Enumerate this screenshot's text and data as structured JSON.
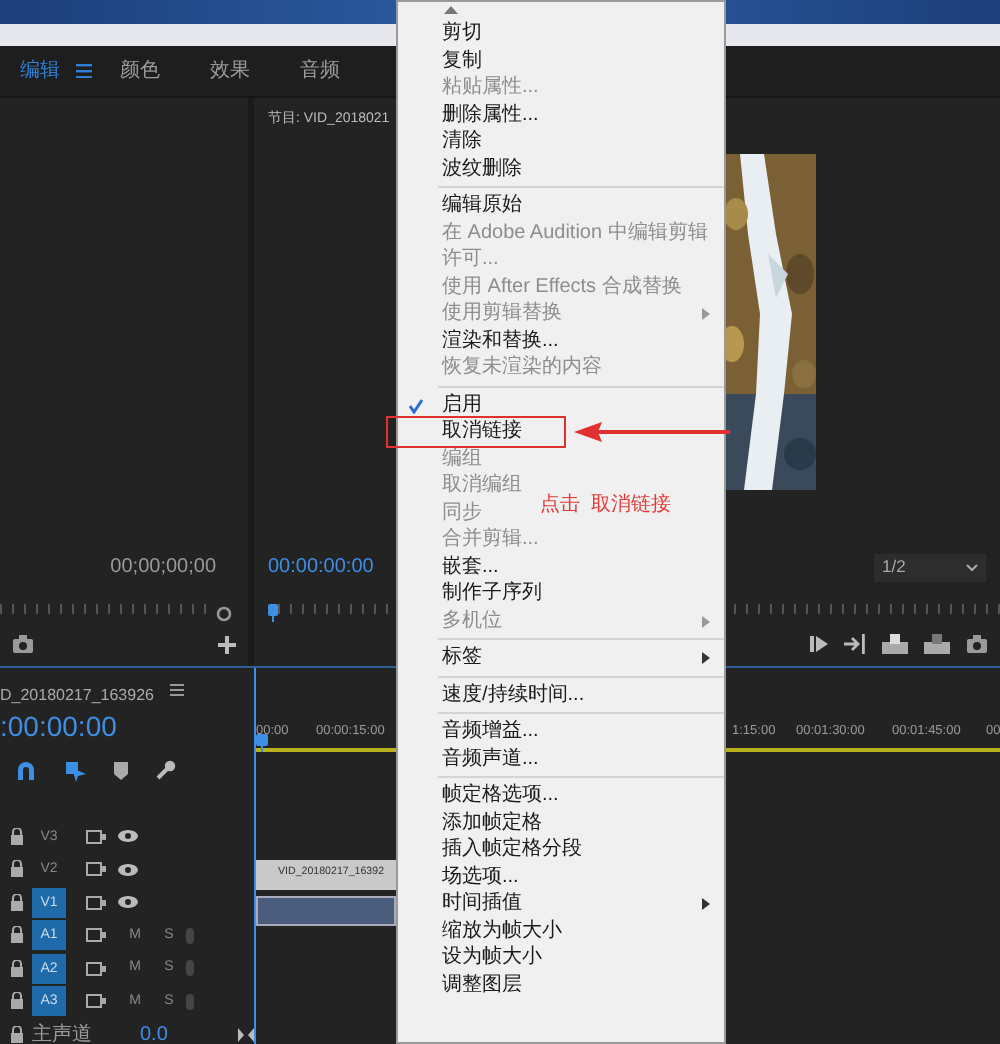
{
  "workspace_tabs": [
    {
      "label": "编辑",
      "selected": true
    },
    {
      "label": "颜色",
      "selected": false
    },
    {
      "label": "效果",
      "selected": false
    },
    {
      "label": "音频",
      "selected": false
    }
  ],
  "source_monitor": {
    "timecode": "00;00;00;00"
  },
  "program_monitor": {
    "title": "节目: VID_2018021",
    "timecode": "00:00:00:00",
    "zoom": "1/2"
  },
  "timeline": {
    "title": "D_20180217_163926",
    "timecode": ":00:00:00",
    "ruler_labels": [
      "00:00",
      "00:00:15:00",
      "1:15:00",
      "00:01:30:00",
      "00:01:45:00",
      "00"
    ],
    "tracks": [
      {
        "label": "V3",
        "kind": "video",
        "targeted": false
      },
      {
        "label": "V2",
        "kind": "video",
        "targeted": false
      },
      {
        "label": "V1",
        "kind": "video",
        "targeted": true
      },
      {
        "label": "A1",
        "kind": "audio",
        "targeted": true,
        "mute": "M",
        "solo": "S"
      },
      {
        "label": "A2",
        "kind": "audio",
        "targeted": true,
        "mute": "M",
        "solo": "S"
      },
      {
        "label": "A3",
        "kind": "audio",
        "targeted": true,
        "mute": "M",
        "solo": "S"
      }
    ],
    "master": {
      "label": "主声道",
      "value": "0.0"
    },
    "video_clip": {
      "label": "VID_20180217_16392"
    }
  },
  "context_menu": {
    "items": [
      {
        "kind": "item",
        "label": "剪切",
        "disabled": false,
        "checked": false,
        "submenu": false,
        "marked": false
      },
      {
        "kind": "item",
        "label": "复制",
        "disabled": false,
        "checked": false,
        "submenu": false,
        "marked": false
      },
      {
        "kind": "item",
        "label": "粘贴属性...",
        "disabled": true,
        "checked": false,
        "submenu": false,
        "marked": false
      },
      {
        "kind": "item",
        "label": "删除属性...",
        "disabled": false,
        "checked": false,
        "submenu": false,
        "marked": false
      },
      {
        "kind": "item",
        "label": "清除",
        "disabled": false,
        "checked": false,
        "submenu": false,
        "marked": false
      },
      {
        "kind": "item",
        "label": "波纹删除",
        "disabled": false,
        "checked": false,
        "submenu": false,
        "marked": false
      },
      {
        "kind": "separator"
      },
      {
        "kind": "item",
        "label": "编辑原始",
        "disabled": false,
        "checked": false,
        "submenu": false,
        "marked": false
      },
      {
        "kind": "item",
        "label": "在 Adobe Audition 中编辑剪辑",
        "disabled": true,
        "checked": false,
        "submenu": false,
        "marked": false
      },
      {
        "kind": "item",
        "label": "许可...",
        "disabled": true,
        "checked": false,
        "submenu": false,
        "marked": false
      },
      {
        "kind": "item",
        "label": "使用 After Effects 合成替换",
        "disabled": true,
        "checked": false,
        "submenu": false,
        "marked": false
      },
      {
        "kind": "item",
        "label": "使用剪辑替换",
        "disabled": true,
        "checked": false,
        "submenu": true,
        "marked": false
      },
      {
        "kind": "item",
        "label": "渲染和替换...",
        "disabled": false,
        "checked": false,
        "submenu": false,
        "marked": false
      },
      {
        "kind": "item",
        "label": "恢复未渲染的内容",
        "disabled": true,
        "checked": false,
        "submenu": false,
        "marked": false
      },
      {
        "kind": "separator"
      },
      {
        "kind": "item",
        "label": "启用",
        "disabled": false,
        "checked": true,
        "submenu": false,
        "marked": false
      },
      {
        "kind": "item",
        "label": "取消链接",
        "disabled": false,
        "checked": false,
        "submenu": false,
        "marked": true
      },
      {
        "kind": "item",
        "label": "编组",
        "disabled": true,
        "checked": false,
        "submenu": false,
        "marked": false
      },
      {
        "kind": "item",
        "label": "取消编组",
        "disabled": true,
        "checked": false,
        "submenu": false,
        "marked": false
      },
      {
        "kind": "item",
        "label": "同步",
        "disabled": true,
        "checked": false,
        "submenu": false,
        "marked": false
      },
      {
        "kind": "item",
        "label": "合并剪辑...",
        "disabled": true,
        "checked": false,
        "submenu": false,
        "marked": false
      },
      {
        "kind": "item",
        "label": "嵌套...",
        "disabled": false,
        "checked": false,
        "submenu": false,
        "marked": false
      },
      {
        "kind": "item",
        "label": "制作子序列",
        "disabled": false,
        "checked": false,
        "submenu": false,
        "marked": false
      },
      {
        "kind": "item",
        "label": "多机位",
        "disabled": true,
        "checked": false,
        "submenu": true,
        "marked": false
      },
      {
        "kind": "separator"
      },
      {
        "kind": "item",
        "label": "标签",
        "disabled": false,
        "checked": false,
        "submenu": true,
        "marked": false
      },
      {
        "kind": "separator"
      },
      {
        "kind": "item",
        "label": "速度/持续时间...",
        "disabled": false,
        "checked": false,
        "submenu": false,
        "marked": false
      },
      {
        "kind": "separator"
      },
      {
        "kind": "item",
        "label": "音频增益...",
        "disabled": false,
        "checked": false,
        "submenu": false,
        "marked": false
      },
      {
        "kind": "item",
        "label": "音频声道...",
        "disabled": false,
        "checked": false,
        "submenu": false,
        "marked": false
      },
      {
        "kind": "separator"
      },
      {
        "kind": "item",
        "label": "帧定格选项...",
        "disabled": false,
        "checked": false,
        "submenu": false,
        "marked": false
      },
      {
        "kind": "item",
        "label": "添加帧定格",
        "disabled": false,
        "checked": false,
        "submenu": false,
        "marked": false
      },
      {
        "kind": "item",
        "label": "插入帧定格分段",
        "disabled": false,
        "checked": false,
        "submenu": false,
        "marked": false
      },
      {
        "kind": "item",
        "label": "场选项...",
        "disabled": false,
        "checked": false,
        "submenu": false,
        "marked": false
      },
      {
        "kind": "item",
        "label": "时间插值",
        "disabled": false,
        "checked": false,
        "submenu": true,
        "marked": false
      },
      {
        "kind": "item",
        "label": "缩放为帧大小",
        "disabled": false,
        "checked": false,
        "submenu": false,
        "marked": false
      },
      {
        "kind": "item",
        "label": "设为帧大小",
        "disabled": false,
        "checked": false,
        "submenu": false,
        "marked": false
      },
      {
        "kind": "item",
        "label": "调整图层",
        "disabled": false,
        "checked": false,
        "submenu": false,
        "marked": false
      }
    ]
  },
  "annotation": {
    "label": "点击  取消链接"
  }
}
